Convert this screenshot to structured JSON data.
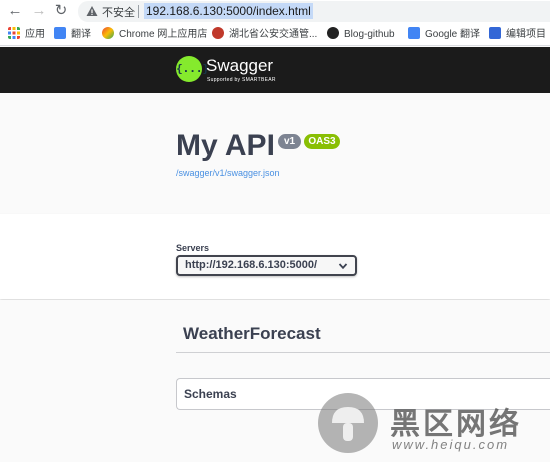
{
  "browser": {
    "back_icon": "arrow-left-icon",
    "forward_icon": "arrow-right-icon",
    "reload_icon": "reload-icon",
    "security_warning": "不安全",
    "url": "192.168.6.130:5000/index.html",
    "bookmarks": [
      {
        "label": "应用",
        "icon": "apps-grid-icon",
        "color": "#ea4335"
      },
      {
        "label": "翻译",
        "icon": "translate-icon",
        "color": "#4285f4"
      },
      {
        "label": "Chrome 网上应用店",
        "icon": "chrome-store-icon",
        "color": "#34a853"
      },
      {
        "label": "湖北省公安交通管...",
        "icon": "police-badge-icon",
        "color": "#c0392b"
      },
      {
        "label": "Blog-github",
        "icon": "notion-icon",
        "color": "#222222"
      },
      {
        "label": "Google 翻译",
        "icon": "translate-icon",
        "color": "#4285f4"
      },
      {
        "label": "编辑项目",
        "icon": "edit-project-icon",
        "color": "#3367d6"
      }
    ]
  },
  "swagger": {
    "logo_glyph": "{...}",
    "logo_title": "Swagger",
    "logo_subtitle": "Supported by SMARTBEAR",
    "brand_color": "#85ea2d",
    "api_title": "My API",
    "version_badge": "v1",
    "oas_badge": "OAS3",
    "spec_url": "/swagger/v1/swagger.json",
    "servers_label": "Servers",
    "selected_server": "http://192.168.6.130:5000/",
    "tag_name": "WeatherForecast",
    "schemas_label": "Schemas"
  },
  "watermark": {
    "text": "黑区网络",
    "url": "www.heiqu.com"
  }
}
